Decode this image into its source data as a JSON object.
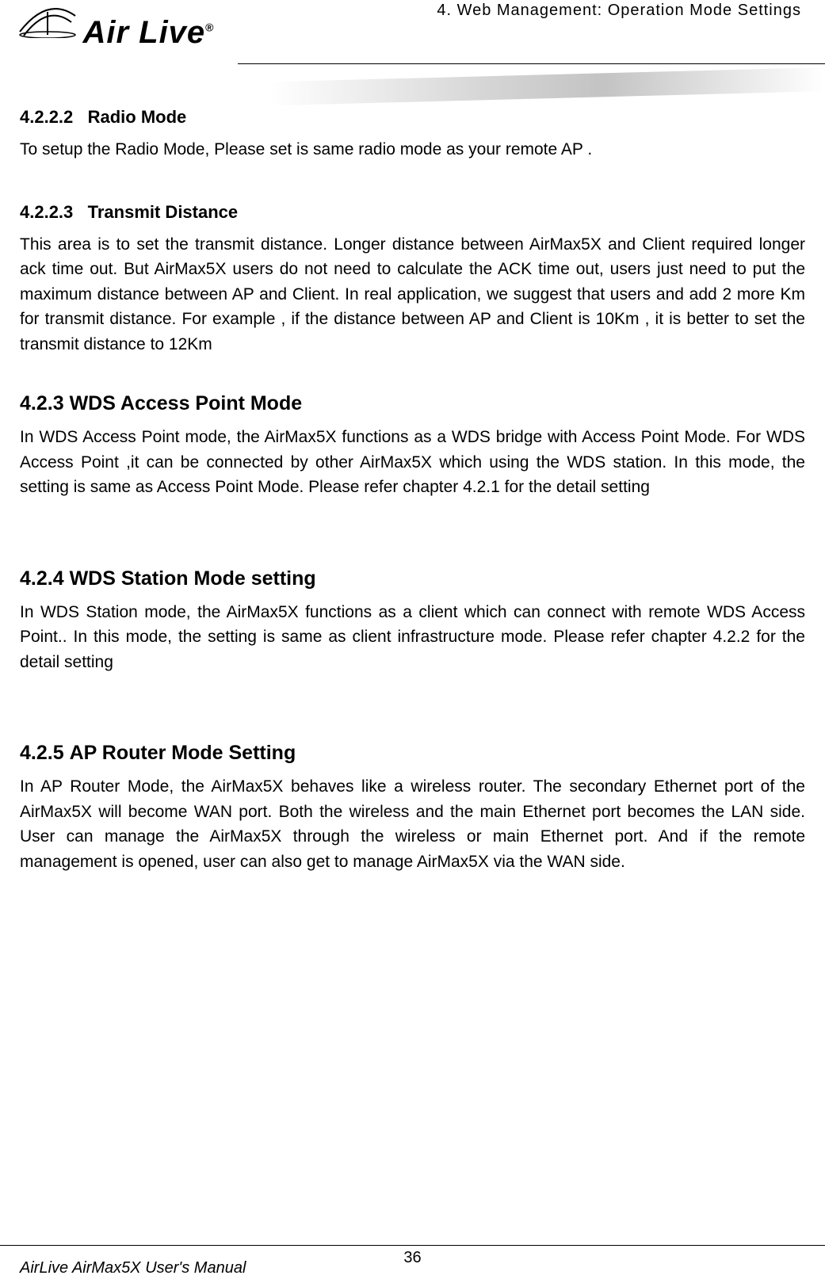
{
  "header": {
    "logo_brand": "Air Live",
    "logo_reg": "®",
    "chapter_title": "4. Web Management: Operation Mode Settings"
  },
  "sections": {
    "s1": {
      "number": "4.2.2.2",
      "title": "Radio Mode",
      "body": "To setup the Radio Mode, Please set is same radio mode as your remote AP ."
    },
    "s2": {
      "number": "4.2.2.3",
      "title": "Transmit Distance",
      "body": "This area is to set the transmit distance. Longer distance between AirMax5X and Client required longer ack time out. But AirMax5X users do not need to calculate the ACK time out, users just need to put the maximum distance between AP and Client. In real application, we suggest that users and add 2 more Km for transmit distance. For example , if the distance between AP and Client is 10Km , it is better to set the transmit distance to 12Km"
    },
    "s3": {
      "number": "4.2.3",
      "title": "WDS Access Point Mode",
      "body": "In WDS Access Point mode, the AirMax5X functions as a WDS bridge with Access Point Mode. For WDS Access Point ,it can be connected by other AirMax5X which using the WDS station. In this mode, the setting is same as Access Point Mode. Please refer chapter 4.2.1 for the detail setting"
    },
    "s4": {
      "number": "4.2.4",
      "title": "WDS Station Mode setting",
      "body": "In WDS Station mode, the AirMax5X functions as a client which can connect with remote WDS Access Point.. In this mode, the setting is same as client infrastructure mode. Please refer chapter 4.2.2 for the detail setting"
    },
    "s5": {
      "number": "4.2.5",
      "title": "AP Router Mode Setting",
      "body": "In AP Router Mode, the AirMax5X behaves like a wireless router. The secondary Ethernet port of the AirMax5X will become WAN port. Both the wireless and the main Ethernet port becomes the LAN side. User can manage the AirMax5X through the wireless or main Ethernet port. And if the remote management is opened, user can also get to manage AirMax5X via the WAN side."
    }
  },
  "footer": {
    "page_number": "36",
    "manual_title": "AirLive AirMax5X User's Manual"
  }
}
